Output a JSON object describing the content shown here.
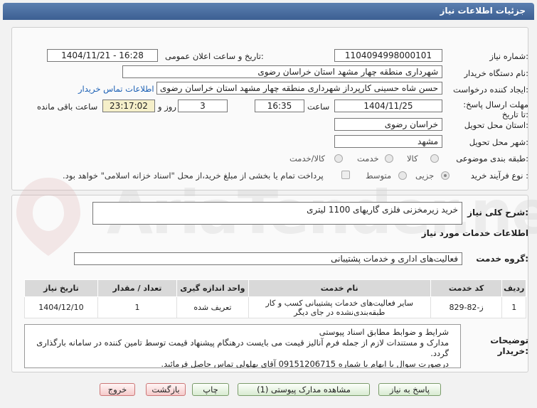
{
  "window": {
    "title": "جزئیات اطلاعات نیاز"
  },
  "fields": {
    "need_number_label": "شماره نیاز:",
    "need_number": "1104094998000101",
    "announce_label": "تاریخ و ساعت اعلان عمومی:",
    "announce_value": "1404/11/21 - 16:28",
    "buyer_org_label": "نام دستگاه خریدار:",
    "buyer_org": "شهرداری منطقه چهار مشهد استان خراسان رضوی",
    "requester_label": "ایجاد کننده درخواست:",
    "requester": "حسن شاه حسینی کارپرداز شهرداری منطقه چهار مشهد استان خراسان رضوی",
    "contact_link": "اطلاعات تماس خریدار",
    "deadline_label": "مهلت ارسال پاسخ: تا تاریخ:",
    "deadline_date": "1404/11/25",
    "time_label": "ساعت",
    "deadline_time": "16:35",
    "days_value": "3",
    "days_label": "روز و",
    "remaining_time": "23:17:02",
    "remaining_label": "ساعت باقی مانده",
    "province_label": "استان محل تحویل:",
    "province": "خراسان رضوی",
    "city_label": "شهر محل تحویل:",
    "city": "مشهد",
    "category_label": "طبقه بندی موضوعی:",
    "category_options": [
      "کالا",
      "خدمت",
      "کالا/خدمت"
    ],
    "process_label": "نوع فرآیند خرید :",
    "process_options": [
      "جزیی",
      "متوسط"
    ],
    "payment_note": "پرداخت تمام یا بخشی از مبلغ خرید،از محل \"اسناد خزانه اسلامی\" خواهد بود."
  },
  "summary": {
    "label": "شرح کلی نیاز:",
    "value": "خرید زیرمخزنی فلزی گاریهای 1100 لیتری"
  },
  "services": {
    "section_title": "اطلاعات خدمات مورد نیاز",
    "group_label": "گروه خدمت:",
    "group_value": "فعالیت‌های اداری و خدمات پشتیبانی"
  },
  "table": {
    "headers": [
      "ردیف",
      "کد خدمت",
      "نام خدمت",
      "واحد اندازه گیری",
      "تعداد / مقدار",
      "تاریخ نیاز"
    ],
    "rows": [
      {
        "row": "1",
        "code": "ز-82-829",
        "name_line1": "سایر فعالیت‌های خدمات پشتیبانی کسب و کار",
        "name_line2": "طبقه‌بندی‌نشده در جای دیگر",
        "unit": "تعریف شده",
        "qty": "1",
        "date": "1404/12/10"
      }
    ]
  },
  "buyer_notes": {
    "label": "توضیحات خریدار:",
    "lines": [
      "شرایط و ضوابط مطابق اسناد پیوستی",
      "مدارک و مستندات لازم از جمله فرم آنالیز قیمت می بایست درهنگام پیشنهاد قیمت توسط تامین کننده در سامانه بارگذاری گردد.",
      "درصورت سوال یا ابهام با شماره 09151206715 آقای بهلولی تماس حاصل فرمائید."
    ]
  },
  "buttons": {
    "reply": "پاسخ به نیاز",
    "attachments": "مشاهده مدارک پیوستی (1)",
    "print": "چاپ",
    "back": "بازگشت",
    "exit": "خروج"
  },
  "watermark": "AriaTender.net",
  "colors": {
    "title_bar": "#3c5f92",
    "link": "#1a5fb4"
  }
}
